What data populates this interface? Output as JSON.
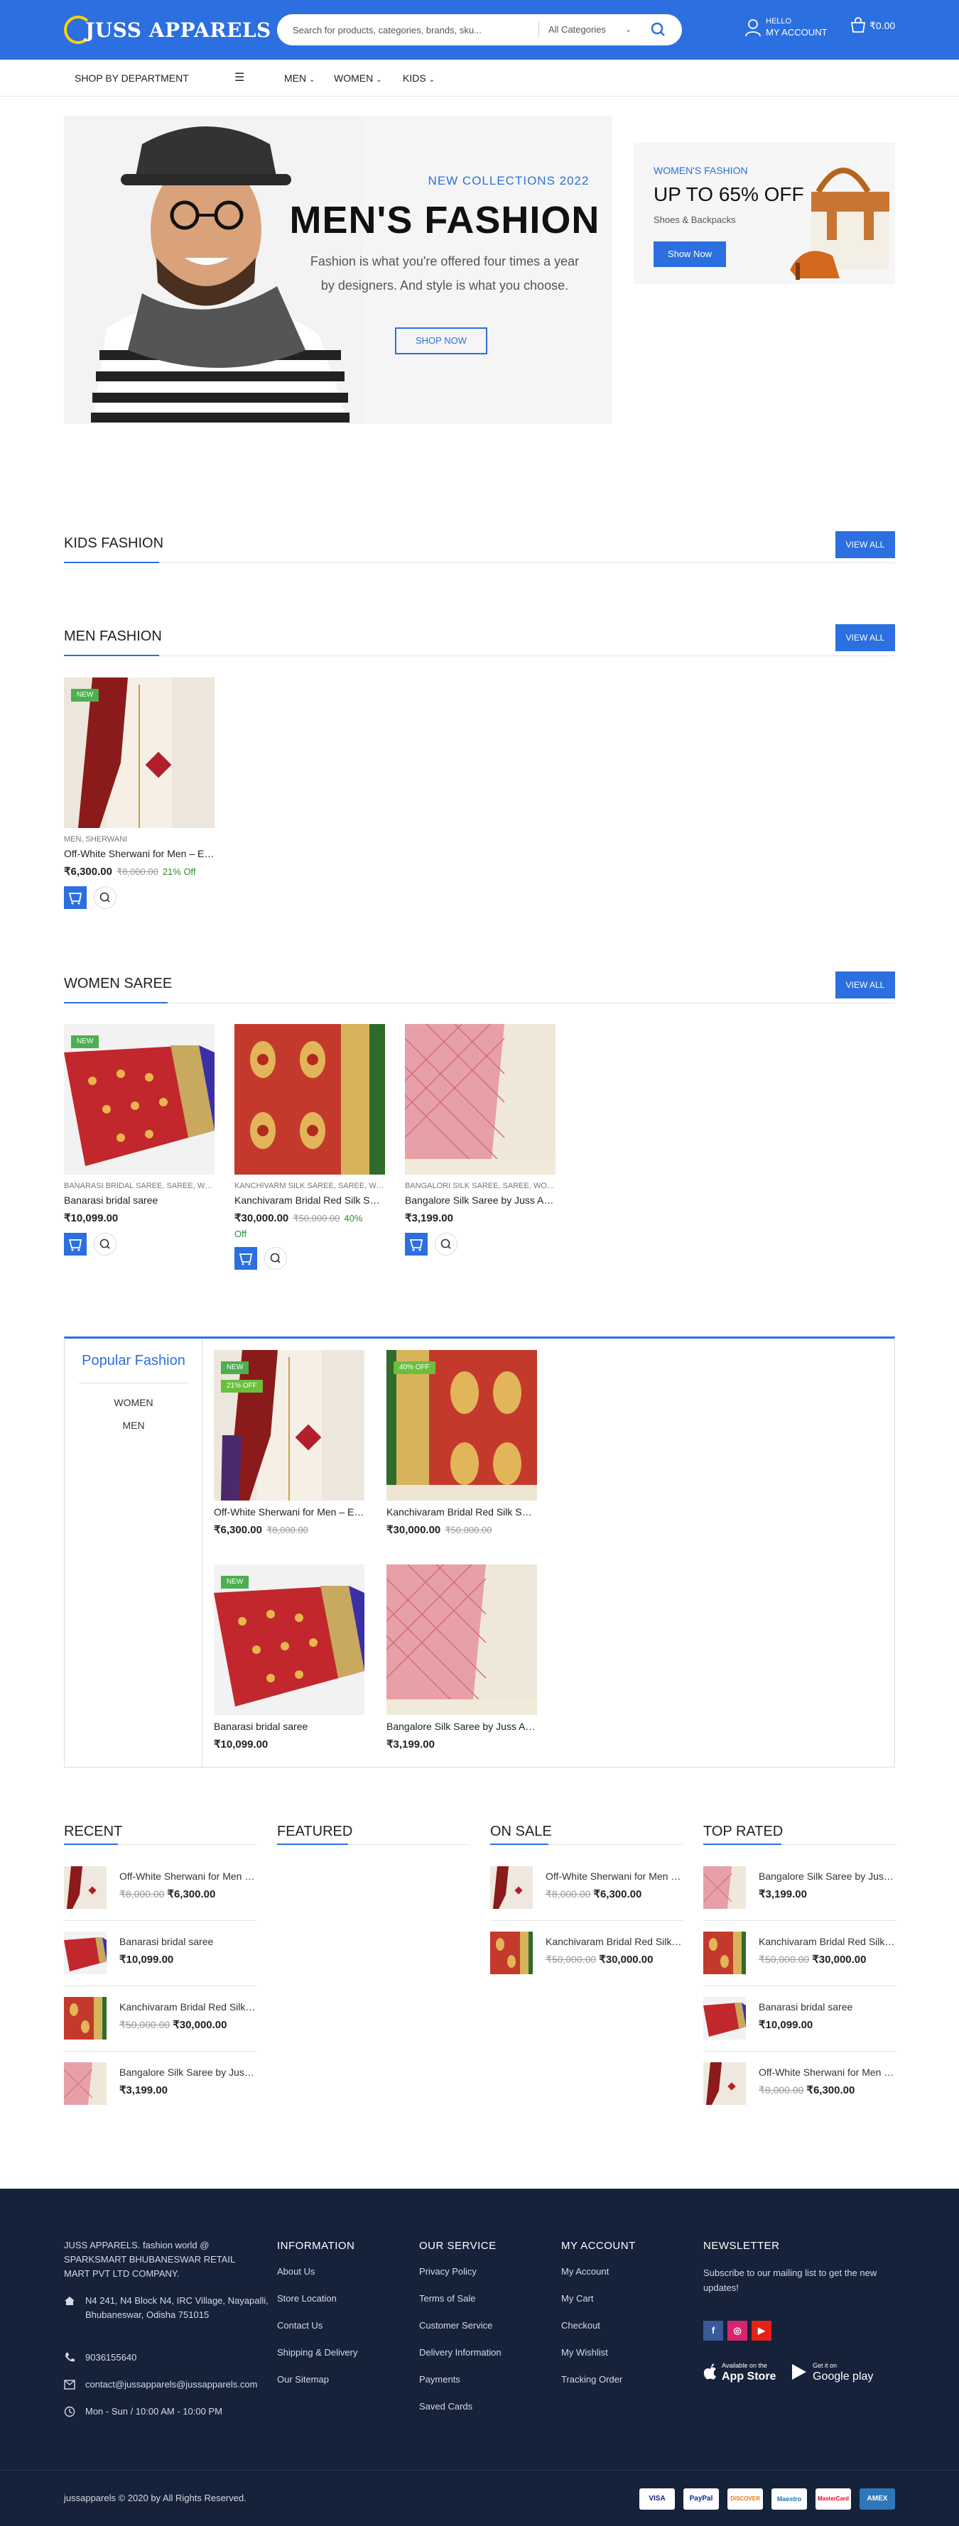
{
  "header": {
    "logo": "JUSS APPARELS",
    "search_placeholder": "Search for products, categories, brands, sku...",
    "category_select": "All Categories",
    "account_hello": "HELLO",
    "account_label": "MY ACCOUNT",
    "cart_total": "₹0.00",
    "colors": {
      "brand": "#2b6fe0"
    }
  },
  "nav": {
    "department": "SHOP BY DEPARTMENT",
    "items": [
      {
        "label": "MEN"
      },
      {
        "label": "WOMEN"
      },
      {
        "label": "KIDS"
      }
    ]
  },
  "hero": {
    "kicker": "NEW COLLECTIONS 2022",
    "title": "MEN'S FASHION",
    "subtitle_line1": "Fashion is what you're offered four times a year",
    "subtitle_line2": "by designers. And style is what you choose.",
    "button": "SHOP NOW"
  },
  "promo": {
    "kicker": "WOMEN'S FASHION",
    "title": "UP TO 65% OFF",
    "subtitle": "Shoes & Backpacks",
    "button": "Show Now"
  },
  "sections": {
    "kids": {
      "title": "KIDS FASHION",
      "view_all": "VIEW ALL"
    },
    "men": {
      "title": "MEN FASHION",
      "view_all": "VIEW ALL"
    },
    "women": {
      "title": "WOMEN SAREE",
      "view_all": "VIEW ALL"
    }
  },
  "men_products": [
    {
      "badge": "NEW",
      "category": "MEN, SHERWANI",
      "name": "Off-White Sherwani for Men – Embroidered",
      "price": "₹6,300.00",
      "old_price": "₹8,000.00",
      "discount": "21% Off"
    }
  ],
  "women_products": [
    {
      "badge": "NEW",
      "category": "BANARASI BRIDAL SAREE, SAREE, WOMEN",
      "name": "Banarasi bridal saree",
      "price": "₹10,099.00",
      "old_price": "",
      "discount": ""
    },
    {
      "badge": "",
      "category": "KANCHIVARM SILK SAREE, SAREE, WOMEN",
      "name": "Kanchivaram Bridal Red Silk Saree",
      "price": "₹30,000.00",
      "old_price": "₹50,000.00",
      "discount": "40%",
      "discount2": "Off"
    },
    {
      "badge": "",
      "category": "BANGALORI SILK SAREE, SAREE, WOMEN",
      "name": "Bangalore Silk Saree by Juss Apparels",
      "price": "₹3,199.00",
      "old_price": "",
      "discount": ""
    }
  ],
  "popular": {
    "title": "Popular Fashion",
    "tabs": [
      "WOMEN",
      "MEN"
    ],
    "products": [
      {
        "badge": "NEW",
        "badge2": "21% OFF",
        "name": "Off-White Sherwani for Men – Embroidered",
        "price": "₹6,300.00",
        "old_price": "₹8,000.00"
      },
      {
        "badge": "40% OFF",
        "name": "Kanchivaram Bridal Red Silk Saree",
        "price": "₹30,000.00",
        "old_price": "₹50,000.00"
      },
      {
        "badge": "NEW",
        "name": "Banarasi bridal saree",
        "price": "₹10,099.00",
        "old_price": ""
      },
      {
        "badge": "",
        "name": "Bangalore Silk Saree by Juss Apparels",
        "price": "₹3,199.00",
        "old_price": ""
      }
    ]
  },
  "lists": {
    "recent": {
      "title": "RECENT",
      "items": [
        {
          "name": "Off-White Sherwani for Men – Embroidered",
          "old_price": "₹8,000.00",
          "price": "₹6,300.00"
        },
        {
          "name": "Banarasi bridal saree",
          "old_price": "",
          "price": "₹10,099.00"
        },
        {
          "name": "Kanchivaram Bridal Red Silk Saree",
          "old_price": "₹50,000.00",
          "price": "₹30,000.00"
        },
        {
          "name": "Bangalore Silk Saree by Juss Apparels",
          "old_price": "",
          "price": "₹3,199.00"
        }
      ]
    },
    "featured": {
      "title": "FEATURED"
    },
    "on_sale": {
      "title": "ON SALE",
      "items": [
        {
          "name": "Off-White Sherwani for Men – Embroidered",
          "old_price": "₹8,000.00",
          "price": "₹6,300.00"
        },
        {
          "name": "Kanchivaram Bridal Red Silk Saree",
          "old_price": "₹50,000.00",
          "price": "₹30,000.00"
        }
      ]
    },
    "top_rated": {
      "title": "TOP RATED",
      "items": [
        {
          "name": "Bangalore Silk Saree by Juss Apparels",
          "old_price": "",
          "price": "₹3,199.00"
        },
        {
          "name": "Kanchivaram Bridal Red Silk Saree",
          "old_price": "₹50,000.00",
          "price": "₹30,000.00"
        },
        {
          "name": "Banarasi bridal saree",
          "old_price": "",
          "price": "₹10,099.00"
        },
        {
          "name": "Off-White Sherwani for Men – Embroidered",
          "old_price": "₹8,000.00",
          "price": "₹6,300.00"
        }
      ]
    }
  },
  "footer": {
    "about": "JUSS APPARELS. fashion world @ SPARKSMART BHUBANESWAR RETAIL MART PVT LTD COMPANY.",
    "address": "N4 241, N4 Block N4, IRC Village, Nayapalli, Bhubaneswar, Odisha 751015",
    "phone": "9036155640",
    "email": "contact@jussapparels@jussapparels.com",
    "hours": "Mon - Sun / 10:00 AM - 10:00 PM",
    "information": {
      "title": "INFORMATION",
      "links": [
        "About Us",
        "Store Location",
        "Contact Us",
        "Shipping & Delivery",
        "Our Sitemap"
      ]
    },
    "service": {
      "title": "OUR SERVICE",
      "links": [
        "Privacy Policy",
        "Terms of Sale",
        "Customer Service",
        "Delivery Information",
        "Payments",
        "Saved Cards"
      ]
    },
    "account": {
      "title": "MY ACCOUNT",
      "links": [
        "My Account",
        "My Cart",
        "Checkout",
        "My Wishlist",
        "Tracking Order"
      ]
    },
    "newsletter": {
      "title": "NEWSLETTER",
      "text": "Subscribe to our mailing list to get the new updates!"
    },
    "app_store": {
      "small": "Available on the",
      "big": "App Store"
    },
    "google_play": {
      "small": "Get it on",
      "big": "Google play"
    },
    "copyright": "jussapparels © 2020 by All Rights Reserved.",
    "payments": [
      "VISA",
      "PayPal",
      "DISCOVER",
      "Maestro",
      "MasterCard",
      "AMEX"
    ]
  }
}
